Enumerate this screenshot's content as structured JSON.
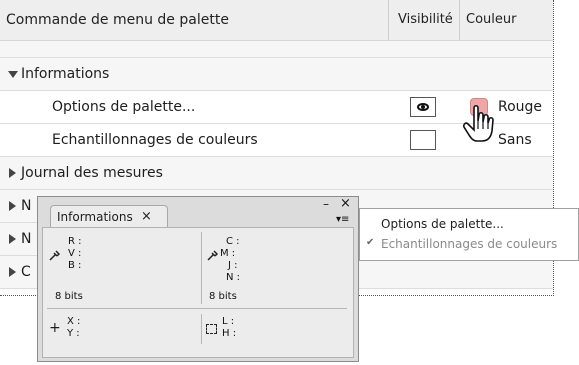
{
  "table": {
    "headers": {
      "command": "Commande de menu de palette",
      "visibility": "Visibilité",
      "color": "Couleur"
    },
    "rows": {
      "informations": "Informations",
      "palette_options": "Options de palette...",
      "color_samplers": "Echantillonnages de couleurs",
      "measure_log": "Journal des mesures",
      "partial_1": "N",
      "partial_2": "N",
      "partial_3": "C"
    },
    "palette_options_color": "Rouge",
    "color_samplers_color": "Sans"
  },
  "panel": {
    "tab_label": "Informations",
    "tab_close": "×",
    "collapse": "–",
    "close": "×",
    "menu_icon": "▾≡",
    "rgb_labels": [
      "R :",
      "V :",
      "B :"
    ],
    "cmyk_labels": [
      "C :",
      "M :",
      "J :",
      "N :"
    ],
    "bits_left": "8 bits",
    "bits_right": "8 bits",
    "xy_labels": [
      "X :",
      "Y :"
    ],
    "lh_labels": [
      "L :",
      "H :"
    ]
  },
  "menu": {
    "items": [
      {
        "label": "Options de palette...",
        "checked": false
      },
      {
        "label": "Echantillonnages de couleurs",
        "checked": true
      }
    ],
    "check_mark": "✔"
  },
  "icons": [
    "expand-triangle-icon",
    "collapse-triangle-icon",
    "eye-icon",
    "hand-cursor-icon",
    "eyedropper-icon",
    "crosshair-icon",
    "selection-icon",
    "close-icon",
    "panel-menu-icon"
  ],
  "colors": {
    "header_bg": "#eeeeee",
    "swatch_red": "#f0a6a6"
  }
}
